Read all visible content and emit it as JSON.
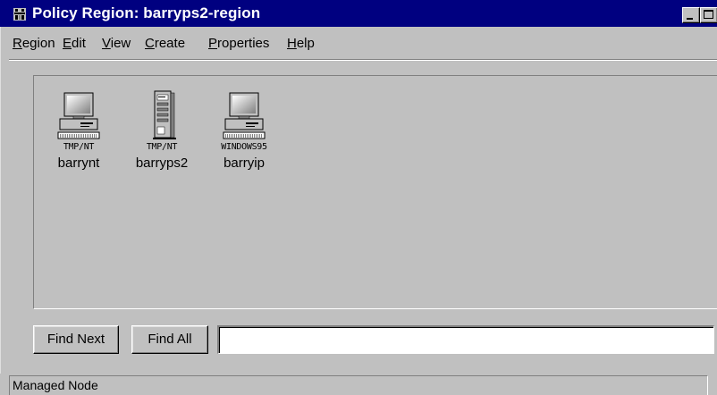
{
  "window": {
    "title": "Policy Region: barryps2-region",
    "colors": {
      "titlebar": "#000080",
      "face": "#c0c0c0",
      "highlight": "#ffffff",
      "shadow": "#808080"
    }
  },
  "menu": {
    "items": [
      "Region",
      "Edit",
      "View",
      "Create",
      "Properties",
      "Help"
    ]
  },
  "nodes": [
    {
      "type": "TMP/NT",
      "name": "barrynt",
      "icon": "desktop-computer-icon"
    },
    {
      "type": "TMP/NT",
      "name": "barryps2",
      "icon": "tower-server-icon"
    },
    {
      "type": "WINDOWS95",
      "name": "barryip",
      "icon": "desktop-computer-icon"
    }
  ],
  "find": {
    "next_label": "Find Next",
    "all_label": "Find All",
    "value": ""
  },
  "status": {
    "text": "Managed Node"
  }
}
